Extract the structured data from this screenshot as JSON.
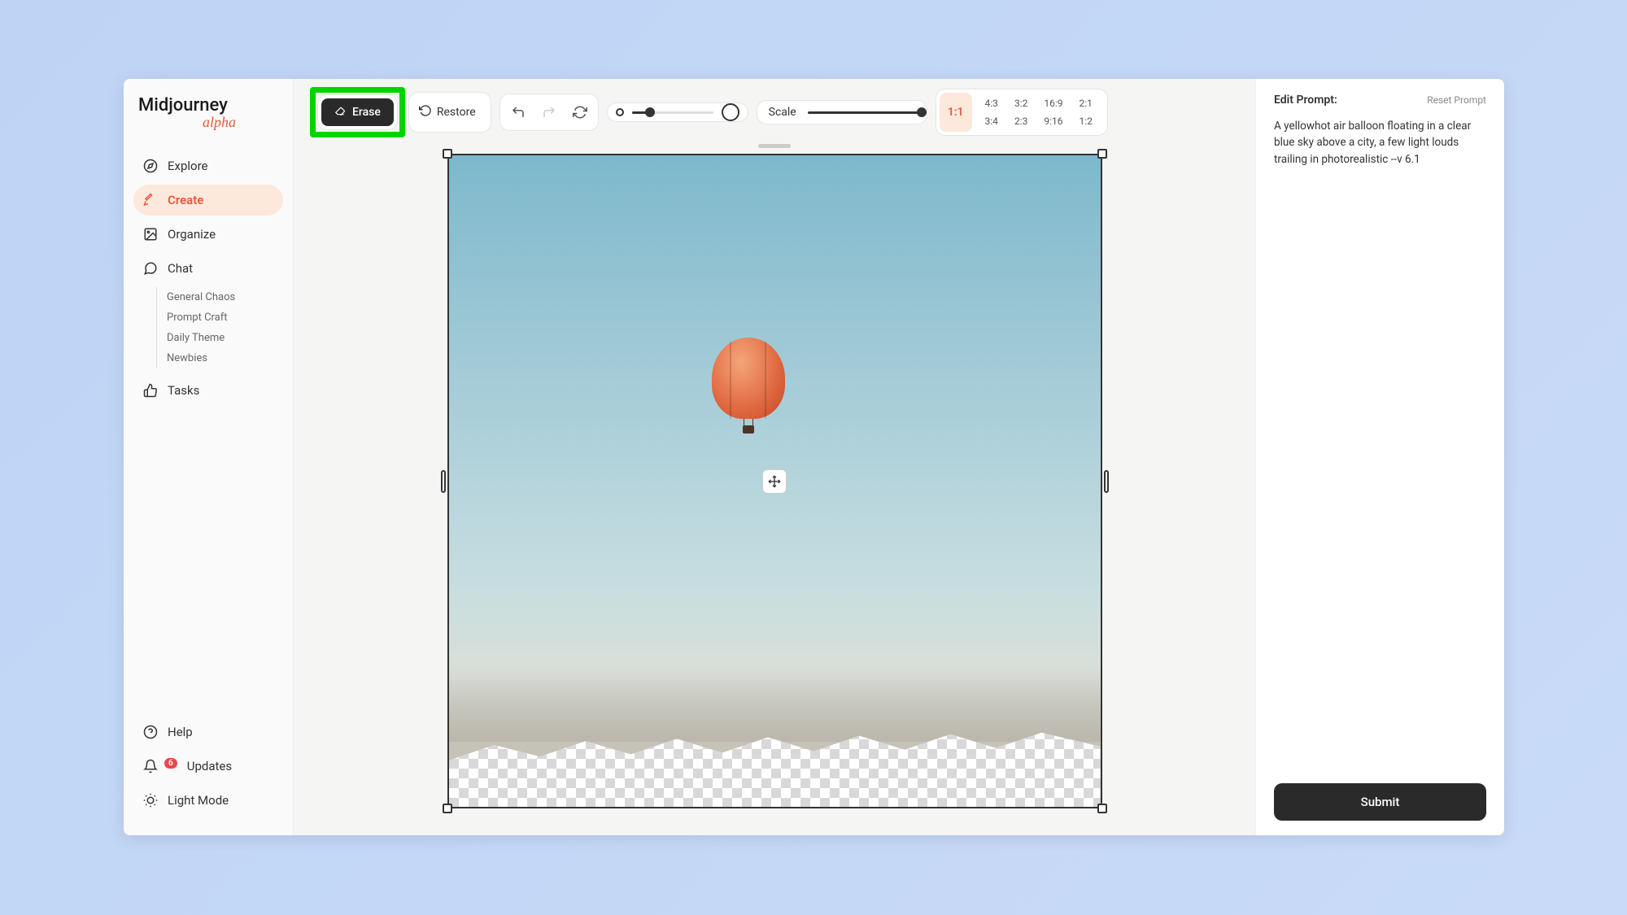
{
  "brand": {
    "name": "Midjourney",
    "tag": "alpha"
  },
  "sidebar": {
    "explore": "Explore",
    "create": "Create",
    "organize": "Organize",
    "chat": "Chat",
    "chatItems": [
      "General Chaos",
      "Prompt Craft",
      "Daily Theme",
      "Newbies"
    ],
    "tasks": "Tasks",
    "help": "Help",
    "updates": "Updates",
    "updatesBadge": "6",
    "lightMode": "Light Mode"
  },
  "toolbar": {
    "erase": "Erase",
    "restore": "Restore",
    "scale": "Scale",
    "activeRatio": "1:1",
    "ratios": [
      "4:3",
      "3:2",
      "16:9",
      "2:1",
      "3:4",
      "2:3",
      "9:16",
      "1:2"
    ]
  },
  "rightPanel": {
    "title": "Edit Prompt:",
    "reset": "Reset Prompt",
    "prompt": "A yellowhot air balloon floating in a clear blue sky above a city, a few light louds trailing in photorealistic --v 6.1",
    "submit": "Submit"
  }
}
